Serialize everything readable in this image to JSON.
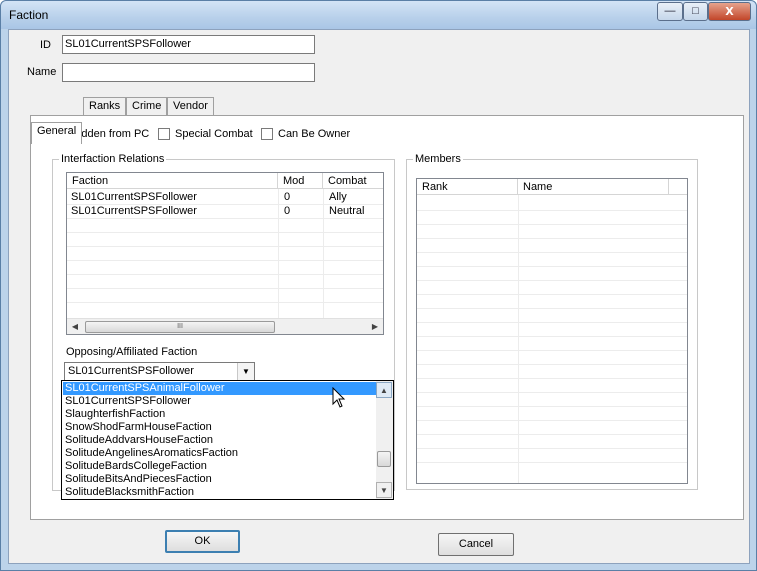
{
  "window": {
    "title": "Faction",
    "minimize": "—",
    "maximize": "□",
    "close": "X"
  },
  "fields": {
    "id_label": "ID",
    "id_value": "SL01CurrentSPSFollower",
    "name_label": "Name",
    "name_value": ""
  },
  "tabs": [
    {
      "label": "General",
      "active": true
    },
    {
      "label": "Ranks",
      "active": false
    },
    {
      "label": "Crime",
      "active": false
    },
    {
      "label": "Vendor",
      "active": false
    }
  ],
  "checkboxes": {
    "hidden_from_pc": "Hidden from PC",
    "special_combat": "Special Combat",
    "can_be_owner": "Can Be Owner"
  },
  "relations": {
    "group_title": "Interfaction Relations",
    "columns": [
      "Faction",
      "Mod",
      "Combat"
    ],
    "rows": [
      {
        "faction": "SL01CurrentSPSFollower",
        "mod": "0",
        "combat": "Ally"
      },
      {
        "faction": "SL01CurrentSPSFollower",
        "mod": "0",
        "combat": "Neutral"
      }
    ],
    "scroll_grip": "III"
  },
  "opposing": {
    "label": "Opposing/Affiliated Faction",
    "selected": "SL01CurrentSPSFollower",
    "options": [
      "SL01CurrentSPSAnimalFollower",
      "SL01CurrentSPSFollower",
      "SlaughterfishFaction",
      "SnowShodFarmHouseFaction",
      "SolitudeAddvarsHouseFaction",
      "SolitudeAngelinesAromaticsFaction",
      "SolitudeBardsCollegeFaction",
      "SolitudeBitsAndPiecesFaction",
      "SolitudeBlacksmithFaction"
    ],
    "highlighted_index": 0
  },
  "members": {
    "group_title": "Members",
    "columns": [
      "Rank",
      "Name"
    ]
  },
  "buttons": {
    "ok": "OK",
    "cancel": "Cancel"
  }
}
